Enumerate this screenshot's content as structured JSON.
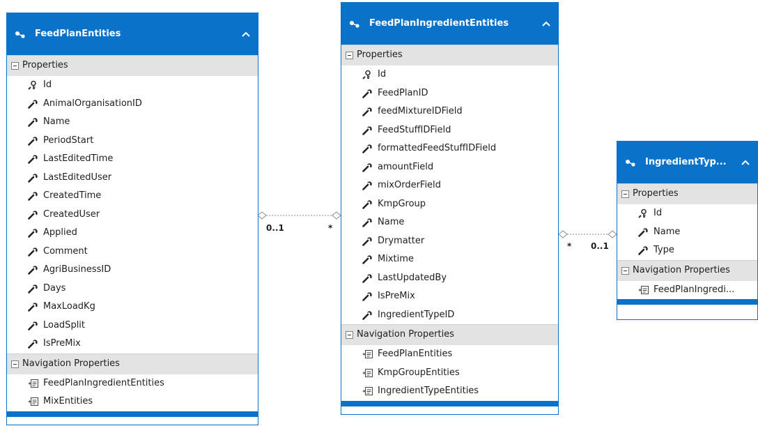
{
  "entities": [
    {
      "title": "FeedPlanEntities",
      "sections": [
        {
          "label": "Properties",
          "items": [
            {
              "name": "Id",
              "icon": "key-wrench-icon"
            },
            {
              "name": "AnimalOrganisationID",
              "icon": "wrench-icon"
            },
            {
              "name": "Name",
              "icon": "wrench-icon"
            },
            {
              "name": "PeriodStart",
              "icon": "wrench-icon"
            },
            {
              "name": "LastEditedTime",
              "icon": "wrench-icon"
            },
            {
              "name": "LastEditedUser",
              "icon": "wrench-icon"
            },
            {
              "name": "CreatedTime",
              "icon": "wrench-icon"
            },
            {
              "name": "CreatedUser",
              "icon": "wrench-icon"
            },
            {
              "name": "Applied",
              "icon": "wrench-icon"
            },
            {
              "name": "Comment",
              "icon": "wrench-icon"
            },
            {
              "name": "AgriBusinessID",
              "icon": "wrench-icon"
            },
            {
              "name": "Days",
              "icon": "wrench-icon"
            },
            {
              "name": "MaxLoadKg",
              "icon": "wrench-icon"
            },
            {
              "name": "LoadSplit",
              "icon": "wrench-icon"
            },
            {
              "name": "IsPreMix",
              "icon": "wrench-icon"
            }
          ]
        },
        {
          "label": "Navigation Properties",
          "items": [
            {
              "name": "FeedPlanIngredientEntities",
              "icon": "navigation-property-icon"
            },
            {
              "name": "MixEntities",
              "icon": "navigation-property-icon"
            }
          ]
        }
      ]
    },
    {
      "title": "FeedPlanIngredientEntities",
      "sections": [
        {
          "label": "Properties",
          "items": [
            {
              "name": "Id",
              "icon": "key-wrench-icon"
            },
            {
              "name": "FeedPlanID",
              "icon": "wrench-icon"
            },
            {
              "name": "feedMixtureIDField",
              "icon": "wrench-icon"
            },
            {
              "name": "FeedStuffIDField",
              "icon": "wrench-icon"
            },
            {
              "name": "formattedFeedStuffIDField",
              "icon": "wrench-icon"
            },
            {
              "name": "amountField",
              "icon": "wrench-icon"
            },
            {
              "name": "mixOrderField",
              "icon": "wrench-icon"
            },
            {
              "name": "KmpGroup",
              "icon": "wrench-icon"
            },
            {
              "name": "Name",
              "icon": "wrench-icon"
            },
            {
              "name": "Drymatter",
              "icon": "wrench-icon"
            },
            {
              "name": "Mixtime",
              "icon": "wrench-icon"
            },
            {
              "name": "LastUpdatedBy",
              "icon": "wrench-icon"
            },
            {
              "name": "IsPreMix",
              "icon": "wrench-icon"
            },
            {
              "name": "IngredientTypeID",
              "icon": "wrench-icon"
            }
          ]
        },
        {
          "label": "Navigation Properties",
          "items": [
            {
              "name": "FeedPlanEntities",
              "icon": "navigation-property-icon"
            },
            {
              "name": "KmpGroupEntities",
              "icon": "navigation-property-icon"
            },
            {
              "name": "IngredientTypeEntities",
              "icon": "navigation-property-icon"
            }
          ]
        }
      ]
    },
    {
      "title": "IngredientTyp...",
      "sections": [
        {
          "label": "Properties",
          "items": [
            {
              "name": "Id",
              "icon": "key-wrench-icon"
            },
            {
              "name": "Name",
              "icon": "wrench-icon"
            },
            {
              "name": "Type",
              "icon": "wrench-icon"
            }
          ]
        },
        {
          "label": "Navigation Properties",
          "items": [
            {
              "name": "FeedPlanIngredi...",
              "icon": "navigation-property-icon"
            }
          ]
        }
      ]
    }
  ],
  "associations": [
    {
      "from": "FeedPlanEntities",
      "to": "FeedPlanIngredientEntities",
      "from_multiplicity": "0..1",
      "to_multiplicity": "*"
    },
    {
      "from": "FeedPlanIngredientEntities",
      "to": "IngredientTyp...",
      "from_multiplicity": "*",
      "to_multiplicity": "0..1"
    }
  ],
  "colors": {
    "header": "#0a72c9",
    "section": "#e3e3e3",
    "connector": "#8a8a8a"
  }
}
